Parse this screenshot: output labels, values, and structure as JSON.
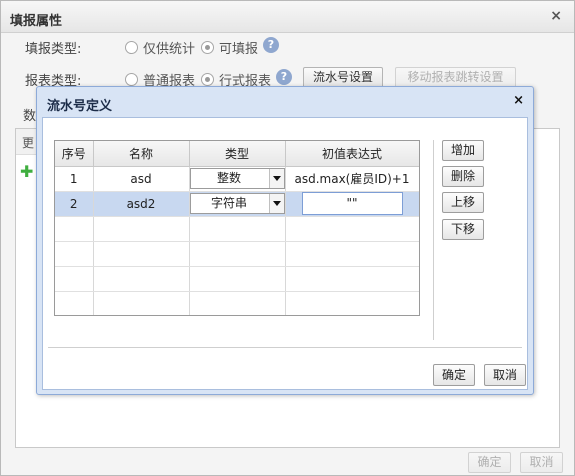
{
  "outer": {
    "title": "填报属性",
    "fill_type": {
      "label": "填报类型:",
      "options": [
        "仅供统计",
        "可填报"
      ],
      "selected": "可填报"
    },
    "report_type": {
      "label": "报表类型:",
      "options": [
        "普通报表",
        "行式报表"
      ],
      "selected": "行式报表"
    },
    "serial_button": "流水号设置",
    "mobile_button": "移动报表跳转设置",
    "side_label": "数",
    "side_header": "更",
    "ok_label": "确定",
    "cancel_label": "取消"
  },
  "modal": {
    "title": "流水号定义",
    "grid": {
      "columns": [
        "序号",
        "名称",
        "类型",
        "初值表达式"
      ],
      "rows": [
        {
          "seq": "1",
          "name": "asd",
          "type": "整数",
          "expr": "asd.max(雇员ID)+1",
          "selected": false
        },
        {
          "seq": "2",
          "name": "asd2",
          "type": "字符串",
          "expr": "\"\"",
          "selected": true
        }
      ]
    },
    "buttons": {
      "add": "增加",
      "delete": "删除",
      "up": "上移",
      "down": "下移"
    },
    "ok_label": "确定",
    "cancel_label": "取消"
  },
  "colors": {
    "modal_bg": "#d8e4f5",
    "selected_row": "#c8d8f0",
    "help_icon": "#8fa7cf"
  }
}
